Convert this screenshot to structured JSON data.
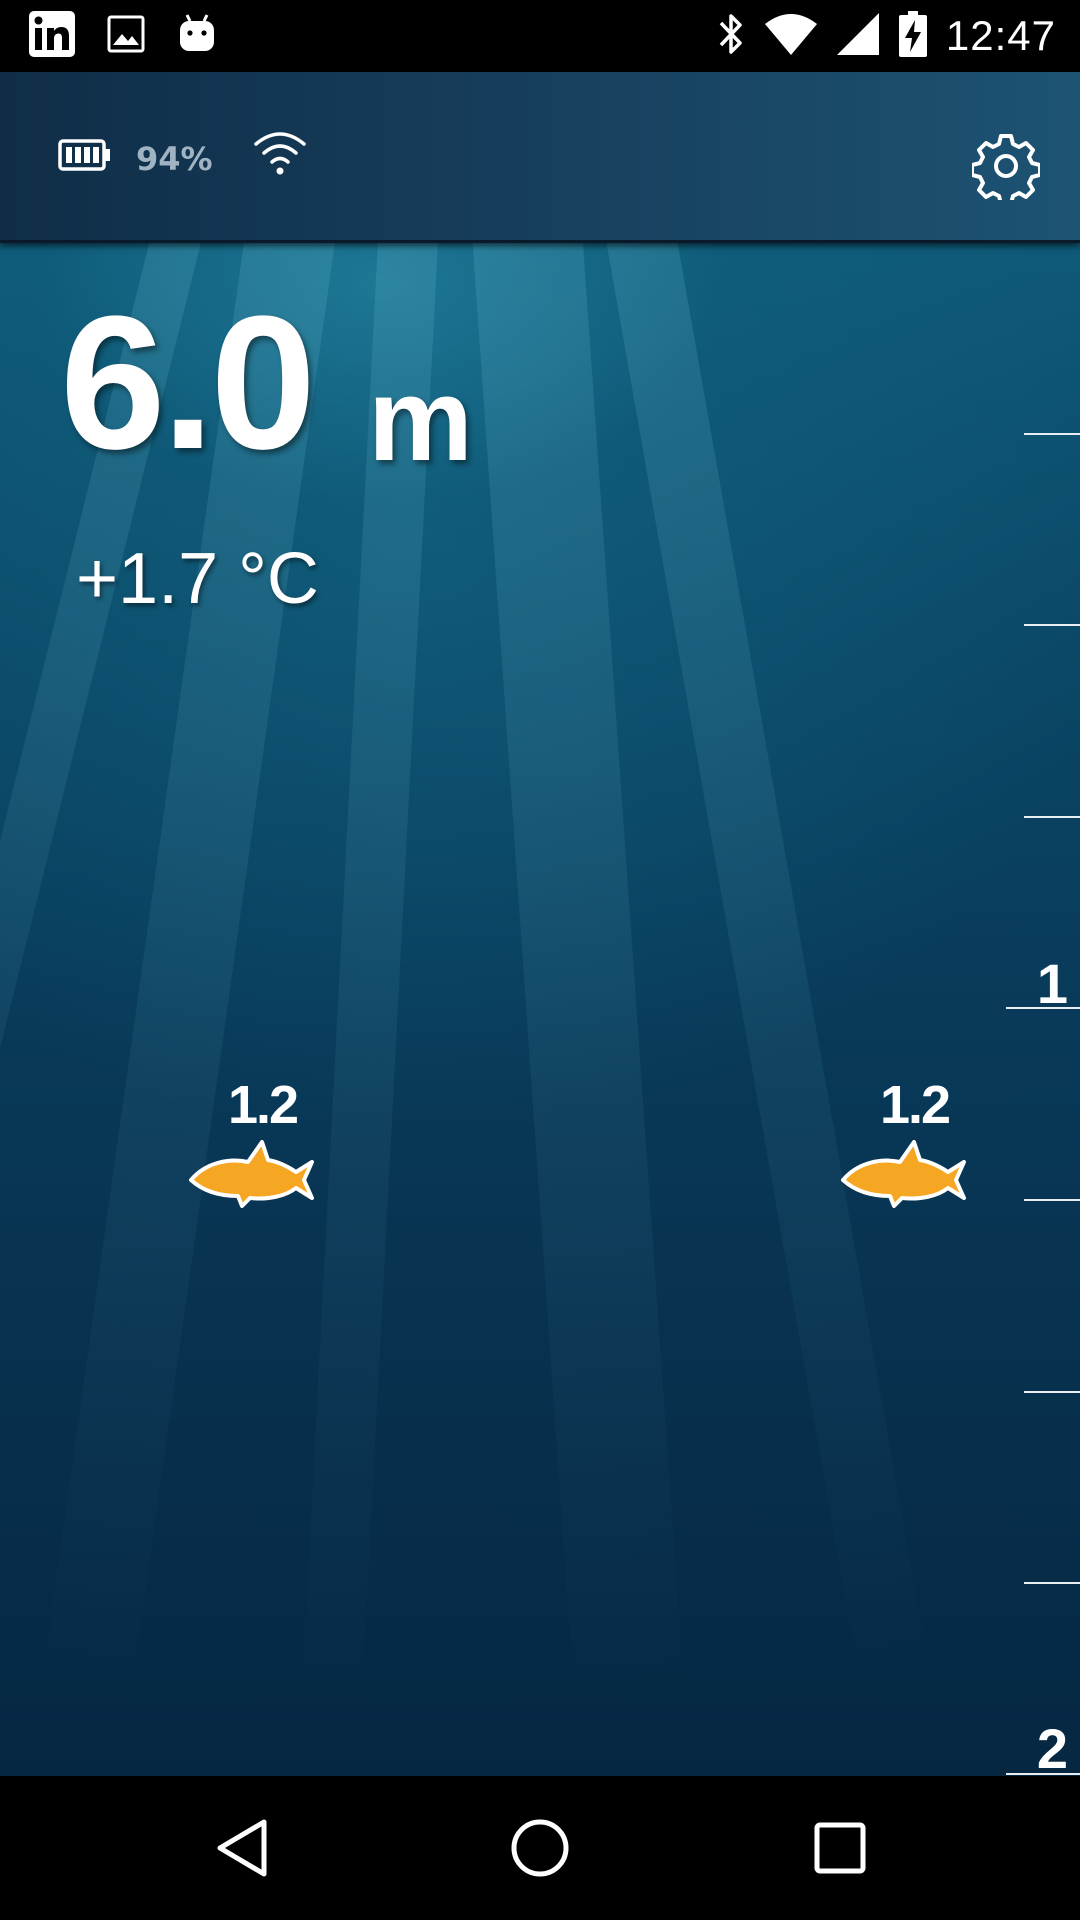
{
  "status_bar": {
    "time": "12:47",
    "left_icons": [
      "linkedin-icon",
      "gallery-icon",
      "android-debug-icon"
    ],
    "right_icons": [
      "bluetooth-icon",
      "wifi-signal-icon",
      "cell-signal-icon",
      "battery-charging-icon"
    ]
  },
  "header": {
    "battery_percent": "94%",
    "icons": [
      "device-battery-icon",
      "device-wifi-icon",
      "settings-gear-icon"
    ]
  },
  "readout": {
    "depth_value": "6.0",
    "depth_unit": "m",
    "temperature": "+1.7 °C"
  },
  "depth_scale": {
    "labels": [
      "1",
      "2"
    ]
  },
  "fish": [
    {
      "depth_label": "1.2"
    },
    {
      "depth_label": "1.2"
    }
  ],
  "colors": {
    "header_bg": "#163d5b",
    "water_top": "#0e5a78",
    "water_bottom": "#062742",
    "fish_fill": "#f5a623",
    "text": "#ffffff",
    "battery_pct_text": "#9fb3c3"
  },
  "nav_bar": {
    "icons": [
      "back-icon",
      "home-icon",
      "recents-icon"
    ]
  }
}
